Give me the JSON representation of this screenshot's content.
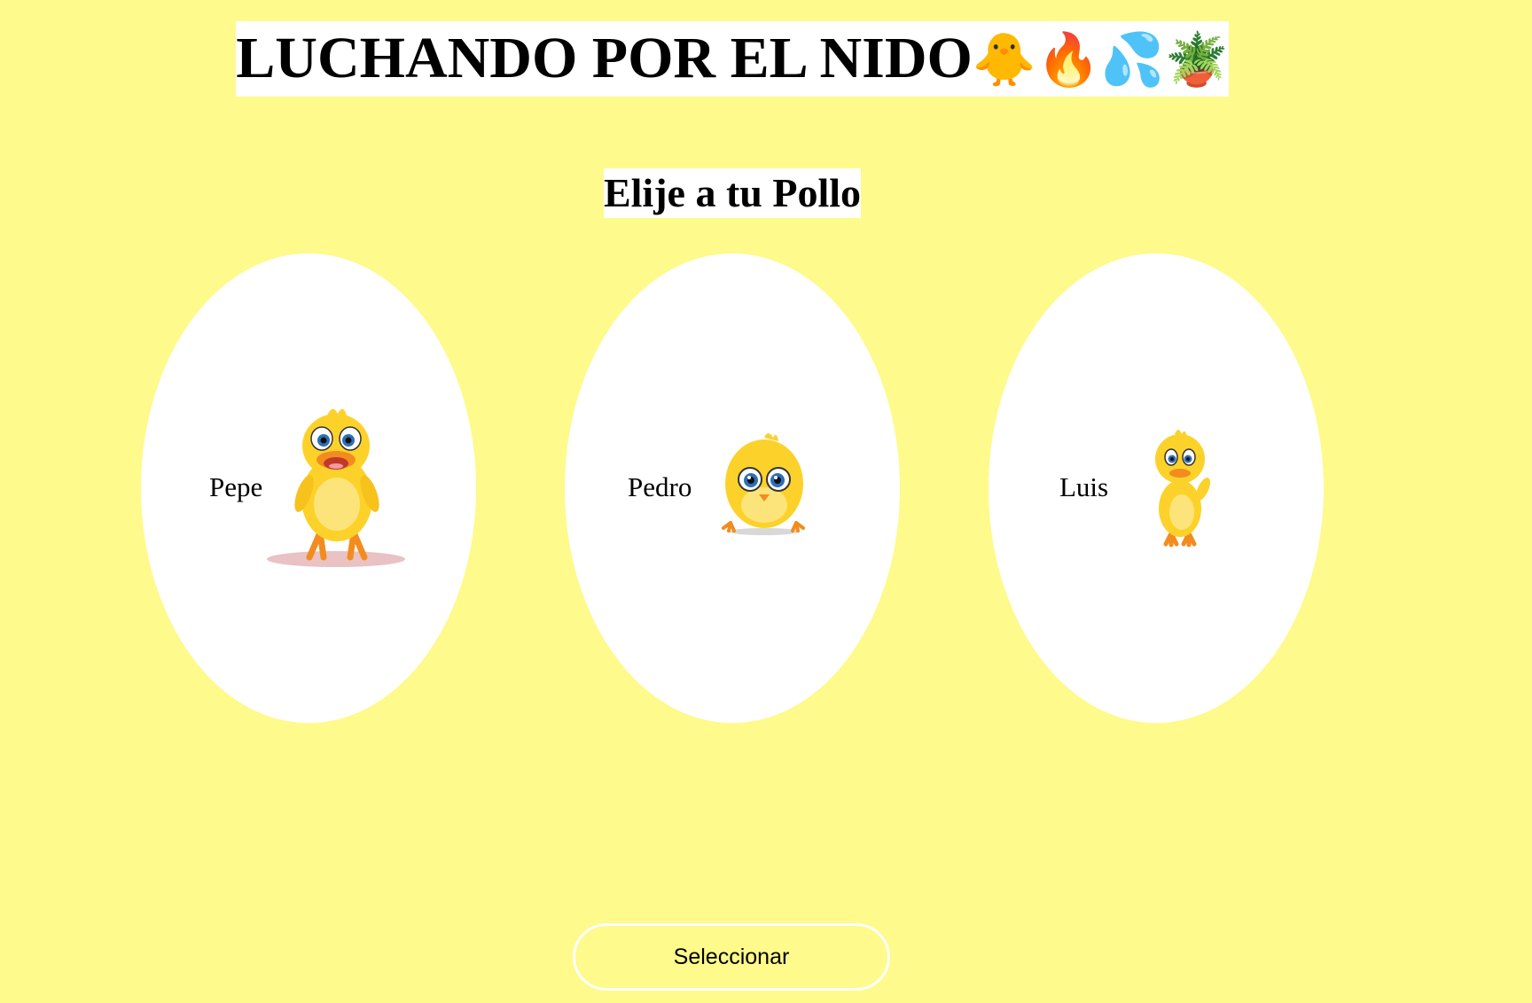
{
  "header": {
    "title": "LUCHANDO POR EL NIDO",
    "title_emojis": "🐥🔥💦🪴",
    "subtitle": "Elije a tu Pollo"
  },
  "options": [
    {
      "name": "Pepe",
      "icon": "duck-standing-icon"
    },
    {
      "name": "Pedro",
      "icon": "chick-sitting-icon"
    },
    {
      "name": "Luis",
      "icon": "duckling-waving-icon"
    }
  ],
  "actions": {
    "select_label": "Seleccionar"
  },
  "colors": {
    "background": "#fefa8b",
    "card": "#ffffff",
    "chick_yellow": "#fcd22a",
    "feet_orange": "#f28c1e"
  }
}
